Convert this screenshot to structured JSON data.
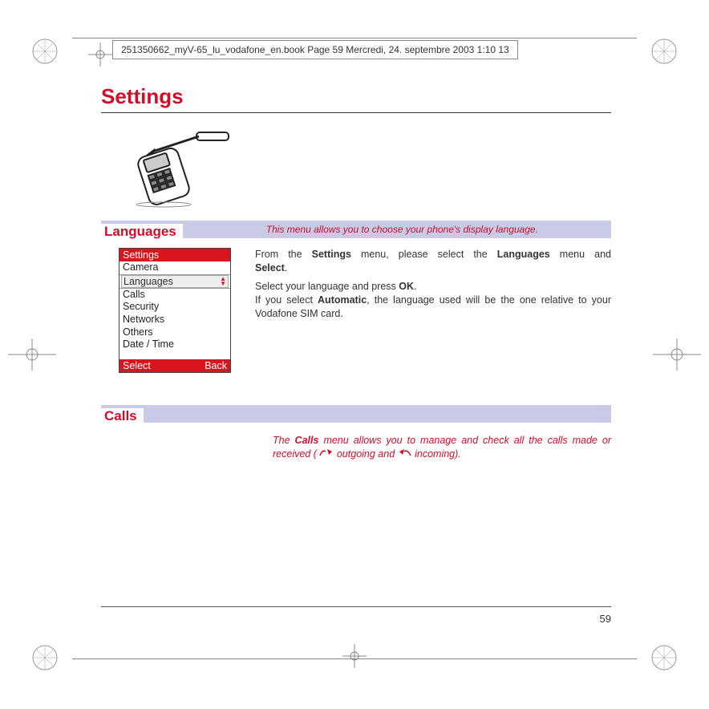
{
  "header": {
    "text": "251350662_myV-65_lu_vodafone_en.book  Page 59  Mercredi, 24. septembre 2003  1:10 13"
  },
  "title": "Settings",
  "languages_section": {
    "label": "Languages",
    "desc": "This menu allows you to choose your phone's display language.",
    "para1a": "From the ",
    "para1b": "Settings",
    "para1c": " menu, please select the ",
    "para1d": "Languages",
    "para1e": " menu and ",
    "para1f": "Select",
    "para1g": ".",
    "para2a": "Select your language and press ",
    "para2b": "OK",
    "para2c": ".",
    "para3a": "If you select ",
    "para3b": "Automatic",
    "para3c": ", the language used will be the one relative to your Vodafone SIM card."
  },
  "phone_menu": {
    "title": "Settings",
    "items": [
      "Camera",
      "Languages",
      "Calls",
      "Security",
      "Networks",
      "Others",
      "Date / Time"
    ],
    "soft_left": "Select",
    "soft_right": "Back"
  },
  "calls_section": {
    "label": "Calls",
    "desc_a": "The ",
    "desc_b": "Calls",
    "desc_c": " menu allows you to manage and check all the calls made or received (",
    "desc_d": " outgoing and ",
    "desc_e": " incoming)."
  },
  "page_number": "59"
}
